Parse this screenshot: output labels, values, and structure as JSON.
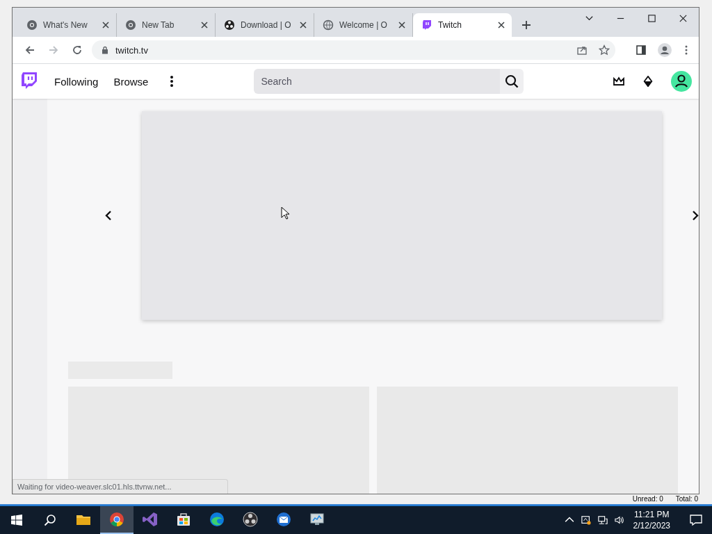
{
  "background_window": {
    "status_bar": [
      "Unread: 0",
      "Total: 0"
    ]
  },
  "browser": {
    "tabs": [
      {
        "label": "What's New",
        "kind": "chrome",
        "selected": false
      },
      {
        "label": "New Tab",
        "kind": "chrome",
        "selected": false
      },
      {
        "label": "Download | O",
        "kind": "obs",
        "selected": false
      },
      {
        "label": "Welcome | O",
        "kind": "globe",
        "selected": false
      },
      {
        "label": "Twitch",
        "kind": "twitch",
        "selected": true
      }
    ],
    "address": "twitch.tv",
    "status_bubble": "Waiting for video-weaver.slc01.hls.ttvnw.net..."
  },
  "site": {
    "nav": [
      "Following",
      "Browse"
    ],
    "search": {
      "placeholder": "Search"
    }
  },
  "taskbar": {
    "apps": [
      {
        "kind": "folder",
        "selected": false
      },
      {
        "kind": "chrome",
        "selected": true
      },
      {
        "kind": "vs",
        "selected": false
      },
      {
        "kind": "store",
        "selected": false
      },
      {
        "kind": "edge",
        "selected": false
      },
      {
        "kind": "obs",
        "selected": false
      },
      {
        "kind": "mail",
        "selected": false
      },
      {
        "kind": "monitor",
        "selected": false
      }
    ],
    "time": "11:21 PM",
    "date": "2/12/2023"
  }
}
